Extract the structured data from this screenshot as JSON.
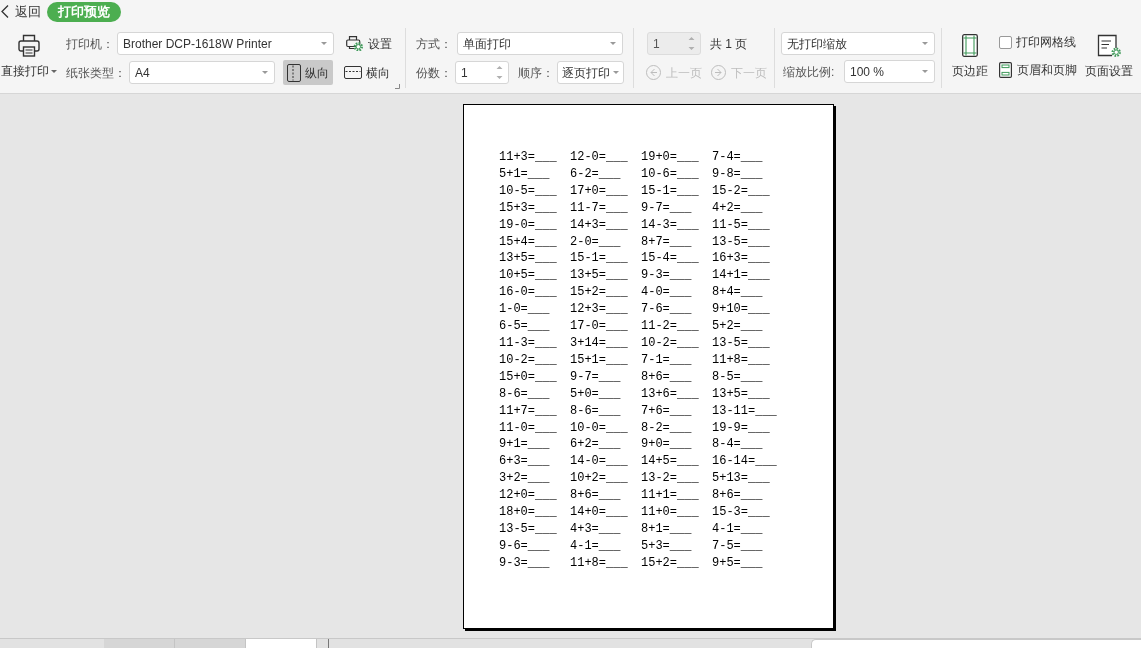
{
  "header": {
    "back": "返回",
    "title": "打印预览"
  },
  "toolbar": {
    "direct_print": "直接打印",
    "printer": {
      "label": "打印机：",
      "value": "Brother DCP-1618W Printer"
    },
    "settings": "设置",
    "paper": {
      "label": "纸张类型：",
      "value": "A4"
    },
    "orientation": [
      {
        "kind": "portrait",
        "label": "纵向",
        "selected": true
      },
      {
        "kind": "landscape",
        "label": "横向",
        "selected": false
      }
    ],
    "mode": {
      "label": "方式：",
      "value": "单面打印"
    },
    "copies": {
      "label": "份数：",
      "value": "1"
    },
    "order": {
      "label": "顺序：",
      "value": "逐页打印"
    },
    "page": {
      "value": "1",
      "disabled": true
    },
    "page_count": "共 1 页",
    "nav": [
      {
        "kind": "previous",
        "label": "上一页",
        "disabled": true
      },
      {
        "kind": "next",
        "label": "下一页",
        "disabled": true
      }
    ],
    "scaling": {
      "value": "无打印缩放"
    },
    "zoom": {
      "label": "缩放比例:",
      "value": "100 %"
    },
    "margins": "页边距",
    "gridlines": {
      "label": "打印网格线",
      "checked": false
    },
    "header_footer": "页眉和页脚",
    "page_setup": "页面设置"
  },
  "worksheet": {
    "rows": [
      [
        "11+3=___",
        "12-0=___",
        "19+0=___",
        "7-4=___"
      ],
      [
        "5+1=___",
        "6-2=___",
        "10-6=___",
        "9-8=___"
      ],
      [
        "10-5=___",
        "17+0=___",
        "15-1=___",
        "15-2=___"
      ],
      [
        "15+3=___",
        "11-7=___",
        "9-7=___",
        "4+2=___"
      ],
      [
        "19-0=___",
        "14+3=___",
        "14-3=___",
        "11-5=___"
      ],
      [
        "15+4=___",
        "2-0=___",
        "8+7=___",
        "13-5=___"
      ],
      [
        "13+5=___",
        "15-1=___",
        "15-4=___",
        "16+3=___"
      ],
      [
        "10+5=___",
        "13+5=___",
        "9-3=___",
        "14+1=___"
      ],
      [
        "16-0=___",
        "15+2=___",
        "4-0=___",
        "8+4=___"
      ],
      [
        "1-0=___",
        "12+3=___",
        "7-6=___",
        "9+10=___"
      ],
      [
        "6-5=___",
        "17-0=___",
        "11-2=___",
        "5+2=___"
      ],
      [
        "11-3=___",
        "3+14=___",
        "10-2=___",
        "13-5=___"
      ],
      [
        "10-2=___",
        "15+1=___",
        "7-1=___",
        "11+8=___"
      ],
      [
        "15+0=___",
        "9-7=___",
        "8+6=___",
        "8-5=___"
      ],
      [
        "8-6=___",
        "5+0=___",
        "13+6=___",
        "13+5=___"
      ],
      [
        "11+7=___",
        "8-6=___",
        "7+6=___",
        "13-11=___"
      ],
      [
        "11-0=___",
        "10-0=___",
        "8-2=___",
        "19-9=___"
      ],
      [
        "9+1=___",
        "6+2=___",
        "9+0=___",
        "8-4=___"
      ],
      [
        "6+3=___",
        "14-0=___",
        "14+5=___",
        "16-14=___"
      ],
      [
        "3+2=___",
        "10+2=___",
        "13-2=___",
        "5+13=___"
      ],
      [
        "12+0=___",
        "8+6=___",
        "11+1=___",
        "8+6=___"
      ],
      [
        "18+0=___",
        "14+0=___",
        "11+0=___",
        "15-3=___"
      ],
      [
        "13-5=___",
        "4+3=___",
        "8+1=___",
        "4-1=___"
      ],
      [
        "9-6=___",
        "4-1=___",
        "5+3=___",
        "7-5=___"
      ],
      [
        "9-3=___",
        "11+8=___",
        "15+2=___",
        "9+5=___"
      ]
    ]
  },
  "sheet_tabs": [
    {
      "selected": false
    },
    {
      "selected": false
    },
    {
      "selected": true
    }
  ]
}
